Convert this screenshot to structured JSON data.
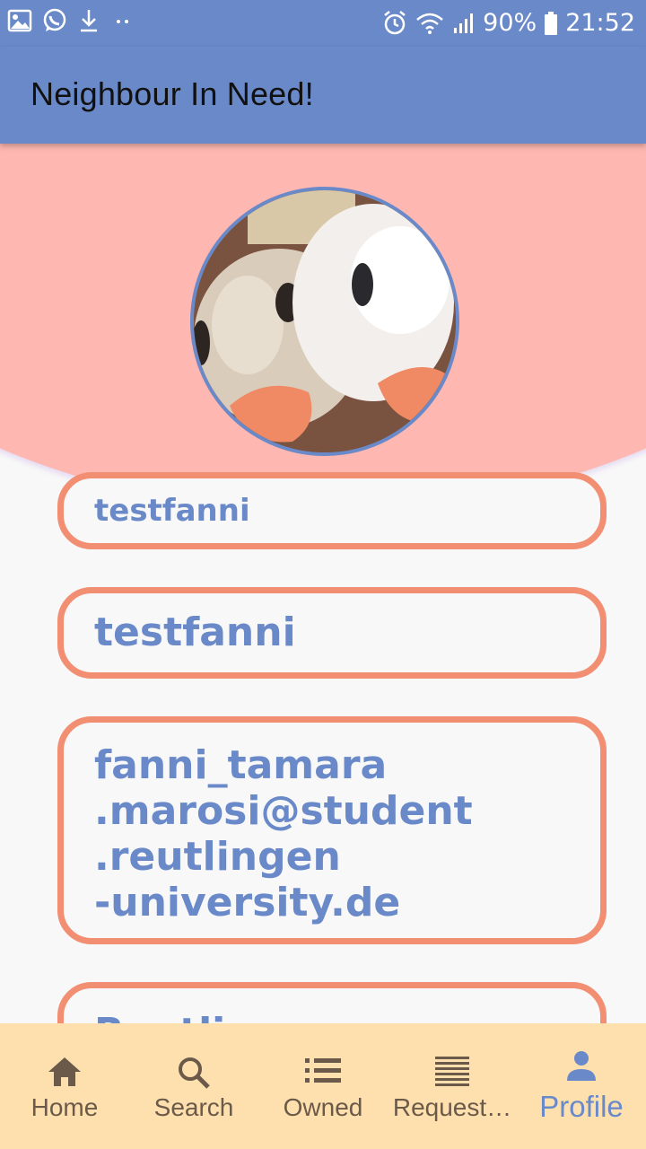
{
  "status_bar": {
    "battery": "90%",
    "time": "21:52",
    "left_icons": [
      "image-icon",
      "whatsapp-icon",
      "download-icon",
      "more-dots-icon"
    ],
    "right_icons": [
      "alarm-icon",
      "wifi-icon",
      "signal-icon",
      "battery-icon"
    ]
  },
  "app_bar": {
    "title": "Neighbour In Need!"
  },
  "profile": {
    "username": "testfanni",
    "display_name": "testfanni",
    "email_lines": [
      "fanni_tamara",
      ".marosi@student",
      ".reutlingen",
      "-university.de"
    ],
    "city": "Reutlingen"
  },
  "bottom_nav": {
    "items": [
      {
        "label": "Home",
        "icon": "home-icon"
      },
      {
        "label": "Search",
        "icon": "search-icon"
      },
      {
        "label": "Owned",
        "icon": "list-icon"
      },
      {
        "label": "Request…",
        "icon": "lines-icon"
      },
      {
        "label": "Profile",
        "icon": "person-icon"
      }
    ],
    "active": "Profile"
  },
  "colors": {
    "primary": "#6a89c8",
    "accent_border": "#f28f72",
    "header_arc": "#ffb8b1",
    "nav_bg": "#fde0ad",
    "nav_inactive": "#6b5a4a"
  }
}
